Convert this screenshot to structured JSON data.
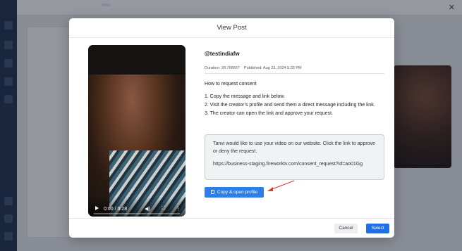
{
  "modal": {
    "title": "View Post",
    "handle": "@testindiafw",
    "duration_label": "Duration:",
    "duration_value": "28.766667",
    "published_label": "Published:",
    "published_value": "Aug 23, 2024 5:33 PM",
    "how_title": "How to request consent",
    "steps": [
      "1. Copy the message and link below.",
      "2. Visit the creator’s profile and send them a direct message including the link.",
      "3. The creator can open the link and approve your request."
    ],
    "message_text": "Tanvi would like to use your video on our website. Click the link to approve or deny the request.",
    "message_link": "https://business-staging.fireworktv.com/consent_request?id=ao01Gg",
    "copy_button": "Copy & open profile",
    "cancel_button": "Cancel",
    "select_button": "Select"
  },
  "video": {
    "time": "0:00 / 0:28",
    "progress_fraction": 0.0
  },
  "colors": {
    "primary": "#1f6fe5",
    "annotation_arrow": "#e03a2f"
  }
}
